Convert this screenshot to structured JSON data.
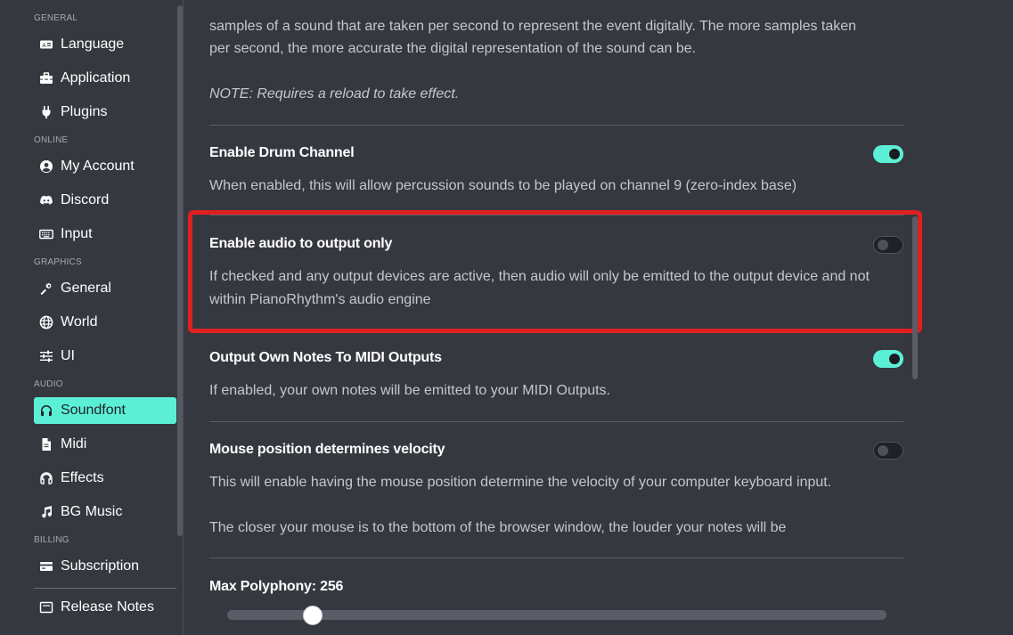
{
  "sidebar": {
    "sections": [
      {
        "head": "GENERAL",
        "items": [
          {
            "label": "Language",
            "icon": "language-icon"
          },
          {
            "label": "Application",
            "icon": "toolbox-icon"
          },
          {
            "label": "Plugins",
            "icon": "plug-icon"
          }
        ]
      },
      {
        "head": "ONLINE",
        "items": [
          {
            "label": "My Account",
            "icon": "account-icon"
          },
          {
            "label": "Discord",
            "icon": "discord-icon"
          },
          {
            "label": "Input",
            "icon": "keyboard-icon"
          }
        ]
      },
      {
        "head": "GRAPHICS",
        "items": [
          {
            "label": "General",
            "icon": "gear-wrench-icon"
          },
          {
            "label": "World",
            "icon": "globe-icon"
          },
          {
            "label": "UI",
            "icon": "sliders-icon"
          }
        ]
      },
      {
        "head": "AUDIO",
        "items": [
          {
            "label": "Soundfont",
            "icon": "headphones-icon",
            "active": true
          },
          {
            "label": "Midi",
            "icon": "file-icon"
          },
          {
            "label": "Effects",
            "icon": "headphones-icon"
          },
          {
            "label": "BG Music",
            "icon": "music-note-icon"
          }
        ]
      },
      {
        "head": "BILLING",
        "items": [
          {
            "label": "Subscription",
            "icon": "card-icon"
          }
        ]
      }
    ],
    "cut_item": {
      "label": "Release Notes",
      "icon": "notes-icon"
    }
  },
  "content": {
    "sample_rate_desc_top": "samples of a sound that are taken per second to represent the event digitally. The more samples taken",
    "sample_rate_desc_bottom": "per second, the more accurate the digital representation of the sound can be.",
    "sample_rate_note": "NOTE: Requires a reload to take effect.",
    "settings": [
      {
        "title": "Enable Drum Channel",
        "desc": "When enabled, this will allow percussion sounds to be played on channel 9 (zero-index base)",
        "enabled": true
      },
      {
        "title": "Enable audio to output only",
        "desc": "If checked and any output devices are active, then audio will only be emitted to the output device and not within PianoRhythm's audio engine",
        "enabled": false
      },
      {
        "title": "Output Own Notes To MIDI Outputs",
        "desc": "If enabled, your own notes will be emitted to your MIDI Outputs.",
        "enabled": true
      },
      {
        "title": "Mouse position determines velocity",
        "desc": "This will enable having the mouse position determine the velocity of your computer keyboard input.",
        "desc2": "The closer your mouse is to the bottom of the browser window, the louder your notes will be",
        "enabled": false
      }
    ],
    "max_polyphony": {
      "label": "Max Polyphony: 256",
      "value": 256,
      "fraction": 0.13
    }
  },
  "colors": {
    "accent": "#5bf0d6",
    "background": "#363840",
    "highlight": "#e02020"
  }
}
